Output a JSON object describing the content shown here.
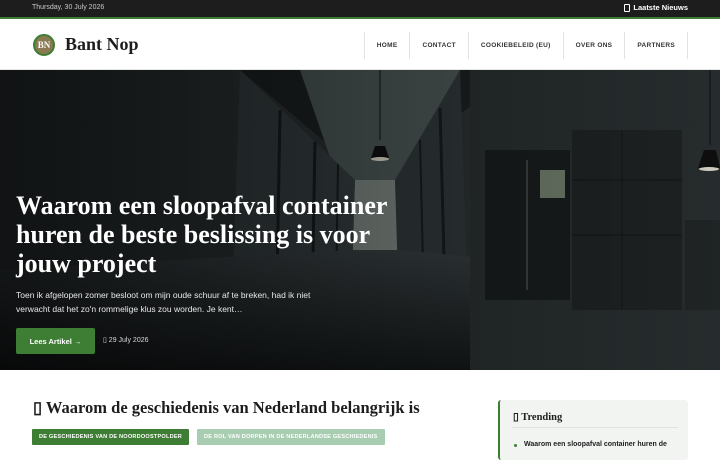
{
  "topbar": {
    "date": "Thursday, 30 July 2026",
    "news_label": "Laatste Nieuws",
    "news_icon": "newspaper-icon"
  },
  "header": {
    "logo_initials": "BN",
    "brand": "Bant Nop",
    "nav": [
      "HOME",
      "CONTACT",
      "COOKIEBELEID (EU)",
      "OVER ONS",
      "PARTNERS"
    ]
  },
  "hero": {
    "title": "Waarom een sloopafval container huren de beste beslissing is voor jouw project",
    "excerpt": "Toen ik afgelopen zomer besloot om mijn oude schuur af te breken, had ik niet verwacht dat het zo'n rommelige klus zou worden. Je kent…",
    "button": "Lees Artikel →",
    "date": "29 July 2026",
    "date_icon": "calendar-icon"
  },
  "section": {
    "title": "Waarom de geschiedenis van Nederland belangrijk is",
    "title_icon": "bookmark-icon",
    "tags": [
      "DE GESCHIEDENIS VAN DE NOORDOOSTPOLDER",
      "DE ROL VAN DORPEN IN DE NEDERLANDSE GESCHIEDENIS"
    ]
  },
  "trending": {
    "title": "Trending",
    "title_icon": "trending-icon",
    "first_item": "Waarom een sloopafval container huren de"
  },
  "colors": {
    "accent": "#3e7d34",
    "dark": "#1d1d1d",
    "tag_light": "#a8cdb1"
  }
}
